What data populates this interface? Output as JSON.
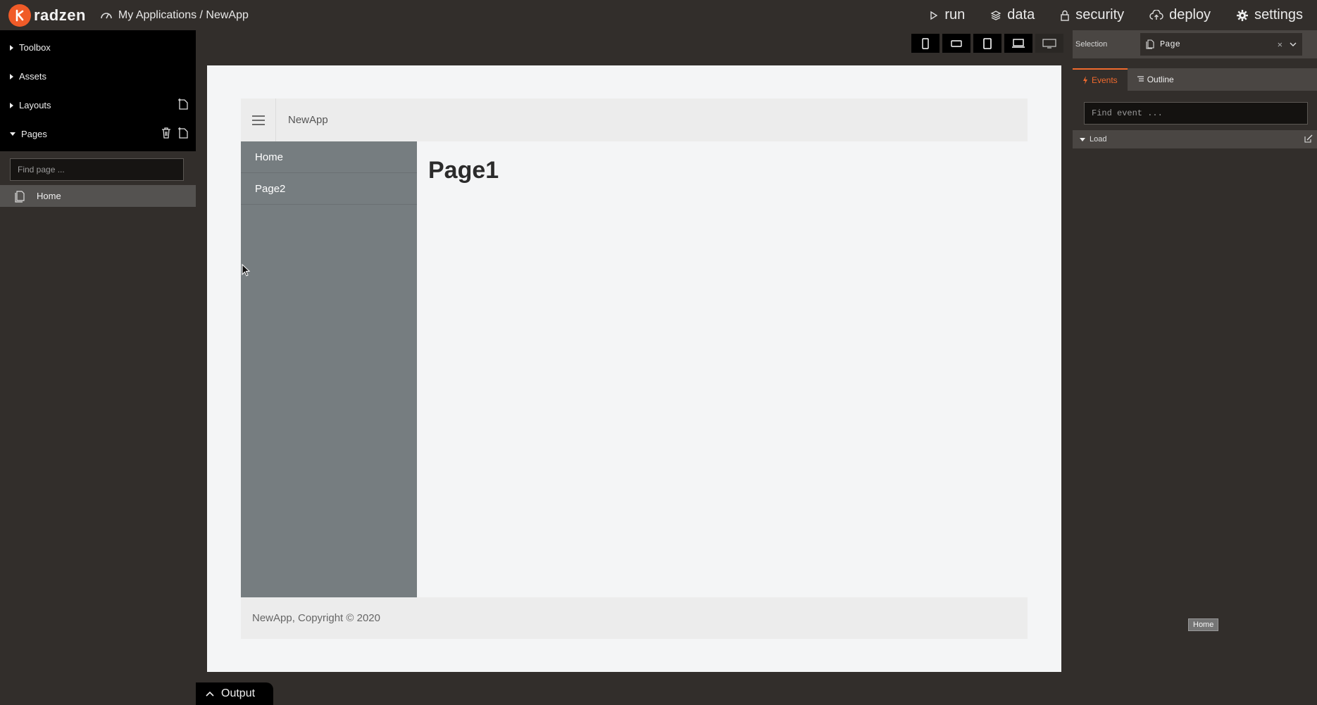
{
  "header": {
    "logo_text": "radzen",
    "breadcrumb": "My Applications / NewApp",
    "nav": [
      {
        "label": "run",
        "icon": "play-icon"
      },
      {
        "label": "data",
        "icon": "layers-icon"
      },
      {
        "label": "security",
        "icon": "lock-icon"
      },
      {
        "label": "deploy",
        "icon": "cloud-upload-icon"
      },
      {
        "label": "settings",
        "icon": "gear-icon"
      }
    ]
  },
  "sidebar": {
    "items": [
      {
        "label": "Toolbox",
        "expanded": false
      },
      {
        "label": "Assets",
        "expanded": false
      },
      {
        "label": "Layouts",
        "expanded": false
      },
      {
        "label": "Pages",
        "expanded": true
      }
    ],
    "find_placeholder": "Find page ...",
    "pages": [
      {
        "label": "Home"
      }
    ]
  },
  "canvas": {
    "app_name": "NewApp",
    "nav_items": [
      "Home",
      "Page2"
    ],
    "heading": "Page1",
    "footer": "NewApp, Copyright © 2020"
  },
  "output": {
    "label": "Output"
  },
  "right_panel": {
    "selection_label": "Selection",
    "selection_value": "Page",
    "tabs": [
      {
        "label": "Events",
        "active": true
      },
      {
        "label": "Outline",
        "active": false
      }
    ],
    "find_placeholder": "Find event ...",
    "event_group": "Load",
    "tooltip": "Home"
  },
  "colors": {
    "accent": "#f05b28",
    "background": "#322e2b",
    "app_sidebar": "#767d80"
  }
}
